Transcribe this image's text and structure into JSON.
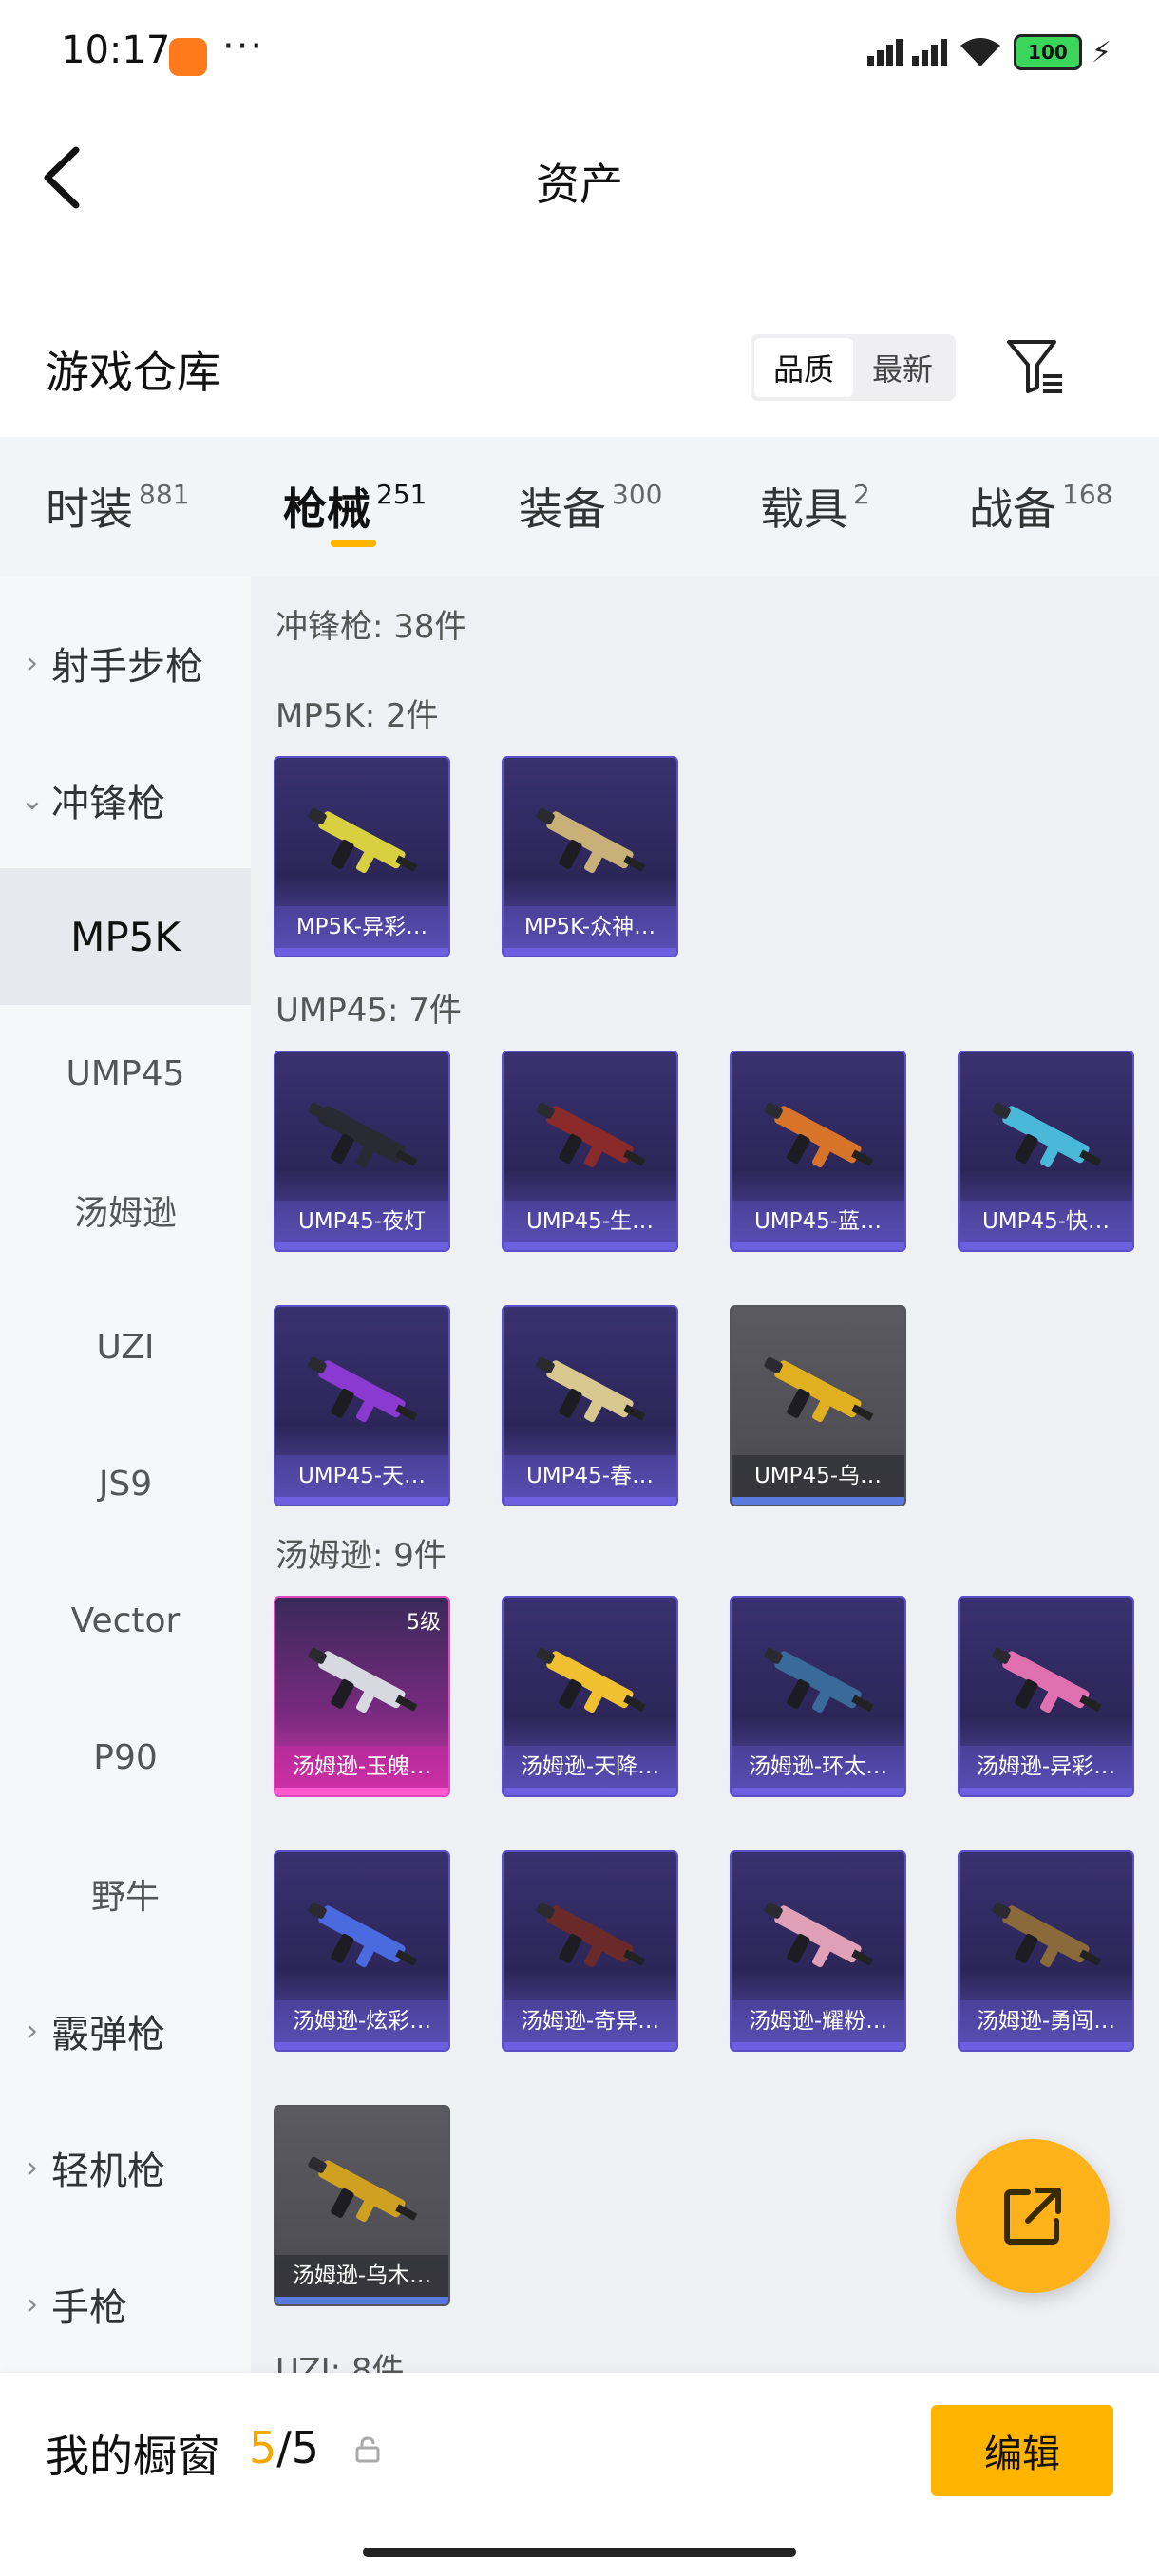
{
  "status_bar": {
    "time": "10:17",
    "dots": "···",
    "battery": "100"
  },
  "header": {
    "title": "资产"
  },
  "warehouse": {
    "title": "游戏仓库",
    "sort_options": [
      "品质",
      "最新"
    ],
    "sort_selected": "品质"
  },
  "tabs": [
    {
      "label": "时装",
      "count": "881"
    },
    {
      "label": "枪械",
      "count": "251",
      "active": true
    },
    {
      "label": "装备",
      "count": "300"
    },
    {
      "label": "载具",
      "count": "2"
    },
    {
      "label": "战备",
      "count": "168"
    }
  ],
  "sidebar": [
    {
      "label": "射手步枪",
      "chevron": "right"
    },
    {
      "label": "冲锋枪",
      "chevron": "down"
    },
    {
      "label": "MP5K",
      "selected": true
    },
    {
      "label": "UMP45"
    },
    {
      "label": "汤姆逊"
    },
    {
      "label": "UZI"
    },
    {
      "label": "JS9"
    },
    {
      "label": "Vector"
    },
    {
      "label": "P90"
    },
    {
      "label": "野牛"
    },
    {
      "label": "霰弹枪",
      "chevron": "right"
    },
    {
      "label": "轻机枪",
      "chevron": "right"
    },
    {
      "label": "手枪",
      "chevron": "right"
    }
  ],
  "content": {
    "category_title": "冲锋枪: 38件",
    "sections": [
      {
        "title": "MP5K: 2件",
        "items": [
          {
            "name": "MP5K-异彩…",
            "rarity": "purple",
            "gun_color": "#d8d040"
          },
          {
            "name": "MP5K-众神…",
            "rarity": "purple",
            "gun_color": "#c8b078"
          }
        ]
      },
      {
        "title": "UMP45: 7件",
        "items": [
          {
            "name": "UMP45-夜灯",
            "rarity": "purple",
            "gun_color": "#2a2a32"
          },
          {
            "name": "UMP45-生…",
            "rarity": "purple",
            "gun_color": "#8a2a2a"
          },
          {
            "name": "UMP45-蓝…",
            "rarity": "purple",
            "gun_color": "#d8742a"
          },
          {
            "name": "UMP45-快…",
            "rarity": "purple",
            "gun_color": "#4ab8d8"
          },
          {
            "name": "UMP45-天…",
            "rarity": "purple",
            "gun_color": "#8a3ad0"
          },
          {
            "name": "UMP45-春…",
            "rarity": "purple",
            "gun_color": "#d8c890"
          },
          {
            "name": "UMP45-乌…",
            "rarity": "gray",
            "gun_color": "#e0b020"
          }
        ]
      },
      {
        "title": "汤姆逊: 9件",
        "items": [
          {
            "name": "汤姆逊-玉魄…",
            "rarity": "pink",
            "gun_color": "#d8d8e0",
            "level": "5级"
          },
          {
            "name": "汤姆逊-天降…",
            "rarity": "purple",
            "gun_color": "#f0c030"
          },
          {
            "name": "汤姆逊-环太…",
            "rarity": "purple",
            "gun_color": "#3a6a9a"
          },
          {
            "name": "汤姆逊-异彩…",
            "rarity": "purple",
            "gun_color": "#e070b0"
          },
          {
            "name": "汤姆逊-炫彩…",
            "rarity": "purple",
            "gun_color": "#4a6ae0"
          },
          {
            "name": "汤姆逊-奇异…",
            "rarity": "purple",
            "gun_color": "#6a2a2a"
          },
          {
            "name": "汤姆逊-耀粉…",
            "rarity": "purple",
            "gun_color": "#e0a0b8"
          },
          {
            "name": "汤姆逊-勇闯…",
            "rarity": "purple",
            "gun_color": "#8a6a3a"
          },
          {
            "name": "汤姆逊-乌木…",
            "rarity": "gray",
            "gun_color": "#d0a020"
          }
        ]
      },
      {
        "title": "UZI: 8件",
        "items": []
      }
    ]
  },
  "bottom_bar": {
    "title": "我的橱窗",
    "count_current": "5",
    "count_total": "/5",
    "edit_label": "编辑"
  }
}
